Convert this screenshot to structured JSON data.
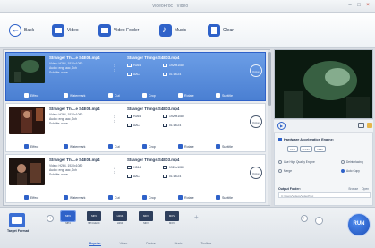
{
  "app": {
    "title": "VideoProc · Video"
  },
  "toolbar": {
    "back": "Back",
    "video": "Video",
    "video_folder": "Video Folder",
    "music": "Music",
    "clear": "Clear"
  },
  "items": [
    {
      "source": "Stranger Thi...e S4E03.mp4",
      "meta1": "Video: H264, 1920x1080",
      "meta2": "Audio: eng, aac, 2ch",
      "meta3": "Subtitle: none",
      "output": "Stranger Things S4E03.mp4",
      "codec": "H264",
      "res": "1920x1080",
      "dur": "01:18:24",
      "audio": "AAC",
      "option": "Option",
      "scene": "#1f3a26"
    },
    {
      "source": "Stranger Thi...e S4E03.mp4",
      "meta1": "Video: H264, 1920x1080",
      "meta2": "Audio: eng, aac, 2ch",
      "meta3": "Subtitle: none",
      "output": "Stranger Things S4E03.mp4",
      "codec": "H264",
      "res": "1920x1080",
      "dur": "01:18:24",
      "audio": "AAC",
      "option": "Option",
      "scene": "#3a1a14"
    },
    {
      "source": "Stranger Thi...e S4E03.mp4",
      "meta1": "Video: H264, 1920x1080",
      "meta2": "Audio: eng, aac, 2ch",
      "meta3": "Subtitle: none",
      "output": "Stranger Things S4E03.mp4",
      "codec": "H264",
      "res": "1920x1080",
      "dur": "01:18:24",
      "audio": "AAC",
      "option": "Option",
      "scene": "#2b1c18"
    }
  ],
  "actions": {
    "effect": "Effect",
    "watermark": "Watermark",
    "cut": "Cut",
    "crop": "Crop",
    "rotate": "Rotate",
    "subtitle": "Subtitle"
  },
  "settings": {
    "hw_title": "Hardware Acceleration Engine:",
    "chips": [
      "Intel",
      "Nvidia",
      "AMD"
    ],
    "use_high_quality": "Use High Quality Engine",
    "deinterlacing": "Deinterlacing",
    "merge": "Merge",
    "auto_copy": "Auto Copy",
    "output_folder": "Output Folder:",
    "browse": "Browse",
    "open": "Open",
    "path": "C:/Users/Videos/VideoProc"
  },
  "bottom": {
    "target_format": "Target Format",
    "tiles": [
      {
        "box": "MP4",
        "name": "MP4"
      },
      {
        "box": "MP4",
        "name": "MP4 HEVC"
      },
      {
        "box": "H264",
        "name": "H264"
      },
      {
        "box": "MKV",
        "name": "MKV"
      },
      {
        "box": "MOV",
        "name": "MOV"
      }
    ],
    "tabs": [
      "Popular",
      "Video",
      "Device",
      "Music",
      "Toolbox"
    ],
    "run": "RUN"
  },
  "colors": {
    "accent": "#2f62c9",
    "selected_row": "#4a7fd2"
  }
}
